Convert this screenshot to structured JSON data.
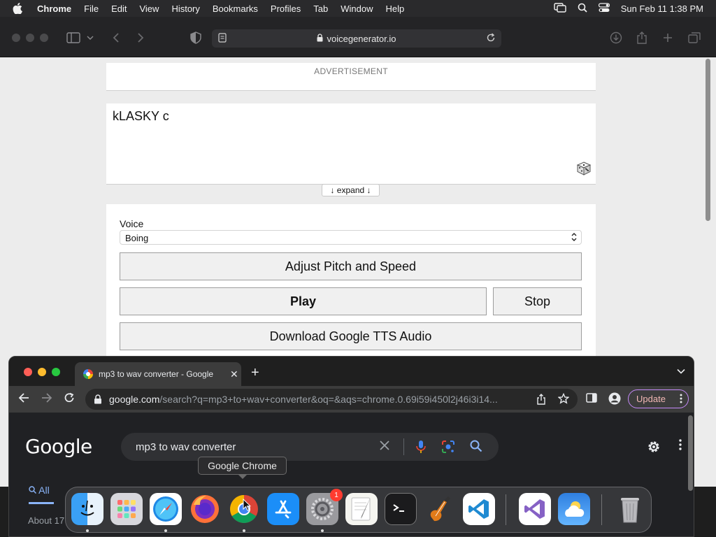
{
  "menubar": {
    "app_name": "Chrome",
    "menus": [
      "File",
      "Edit",
      "View",
      "History",
      "Bookmarks",
      "Profiles",
      "Tab",
      "Window",
      "Help"
    ],
    "datetime": "Sun Feb 11  1:38 PM"
  },
  "safari": {
    "url": "voicegenerator.io",
    "ad_label": "ADVERTISEMENT",
    "text_input": "kLASKY c",
    "expand_label": "↓ expand ↓",
    "voice_label": "Voice",
    "voice_selected": "Boing",
    "adjust_label": "Adjust Pitch and Speed",
    "play_label": "Play",
    "stop_label": "Stop",
    "download_label": "Download Google TTS Audio"
  },
  "chrome": {
    "tab_title": "mp3 to wav converter - Google",
    "url_host": "google.com",
    "url_path": "/search?q=mp3+to+wav+converter&oq=&aqs=chrome.0.69i59i450l2j46i3i14...",
    "update_label": "Update",
    "google_logo": "Google",
    "search_query": "mp3 to wav converter",
    "all_tab": "All",
    "about_text": "About 17"
  },
  "tooltip": "Google Chrome",
  "dock": {
    "items": [
      "Finder",
      "Launchpad",
      "Safari",
      "Firefox",
      "Google Chrome",
      "App Store",
      "System Settings",
      "TextEdit",
      "Terminal",
      "GarageBand",
      "Visual Studio Code",
      "Visual Studio",
      "Weather",
      "Trash"
    ],
    "settings_badge": "1"
  }
}
